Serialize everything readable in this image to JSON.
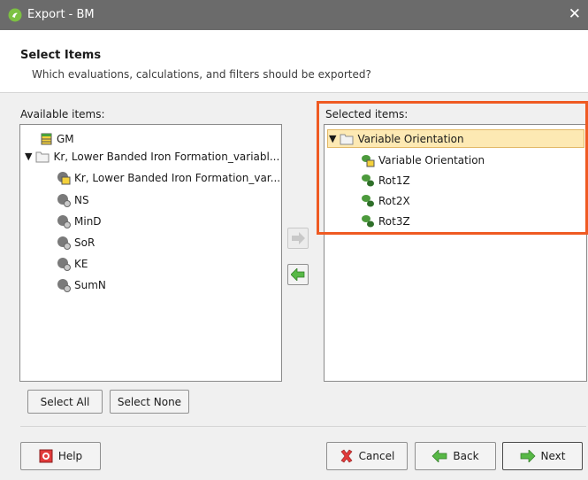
{
  "window": {
    "title": "Export - BM",
    "close_symbol": "✕"
  },
  "header": {
    "title": "Select Items",
    "subtitle": "Which evaluations, calculations, and filters should be exported?"
  },
  "available": {
    "label": "Available items:",
    "items": [
      {
        "label": "GM",
        "icon": "table-icon"
      },
      {
        "label": "Kr, Lower Banded Iron Formation_variabl...",
        "icon": "folder-icon",
        "expander": "▼"
      },
      {
        "label": "Kr, Lower Banded Iron Formation_var...",
        "icon": "kriging-icon"
      },
      {
        "label": "NS",
        "icon": "statistic-icon"
      },
      {
        "label": "MinD",
        "icon": "statistic-icon"
      },
      {
        "label": "SoR",
        "icon": "statistic-icon"
      },
      {
        "label": "KE",
        "icon": "statistic-icon"
      },
      {
        "label": "SumN",
        "icon": "statistic-icon"
      }
    ]
  },
  "selected": {
    "label": "Selected items:",
    "items": [
      {
        "label": "Variable Orientation",
        "icon": "folder-icon",
        "expander": "▼"
      },
      {
        "label": "Variable Orientation",
        "icon": "variable-orientation-icon"
      },
      {
        "label": "Rot1Z",
        "icon": "rotation-icon"
      },
      {
        "label": "Rot2X",
        "icon": "rotation-icon"
      },
      {
        "label": "Rot3Z",
        "icon": "rotation-icon"
      }
    ]
  },
  "buttons": {
    "select_all": "Select All",
    "select_none": "Select None",
    "help": "Help",
    "cancel": "Cancel",
    "back": "Back",
    "next": "Next"
  },
  "colors": {
    "highlight": "#ef5a22",
    "arrow_green": "#57b846",
    "selection": "#fde9b3"
  }
}
